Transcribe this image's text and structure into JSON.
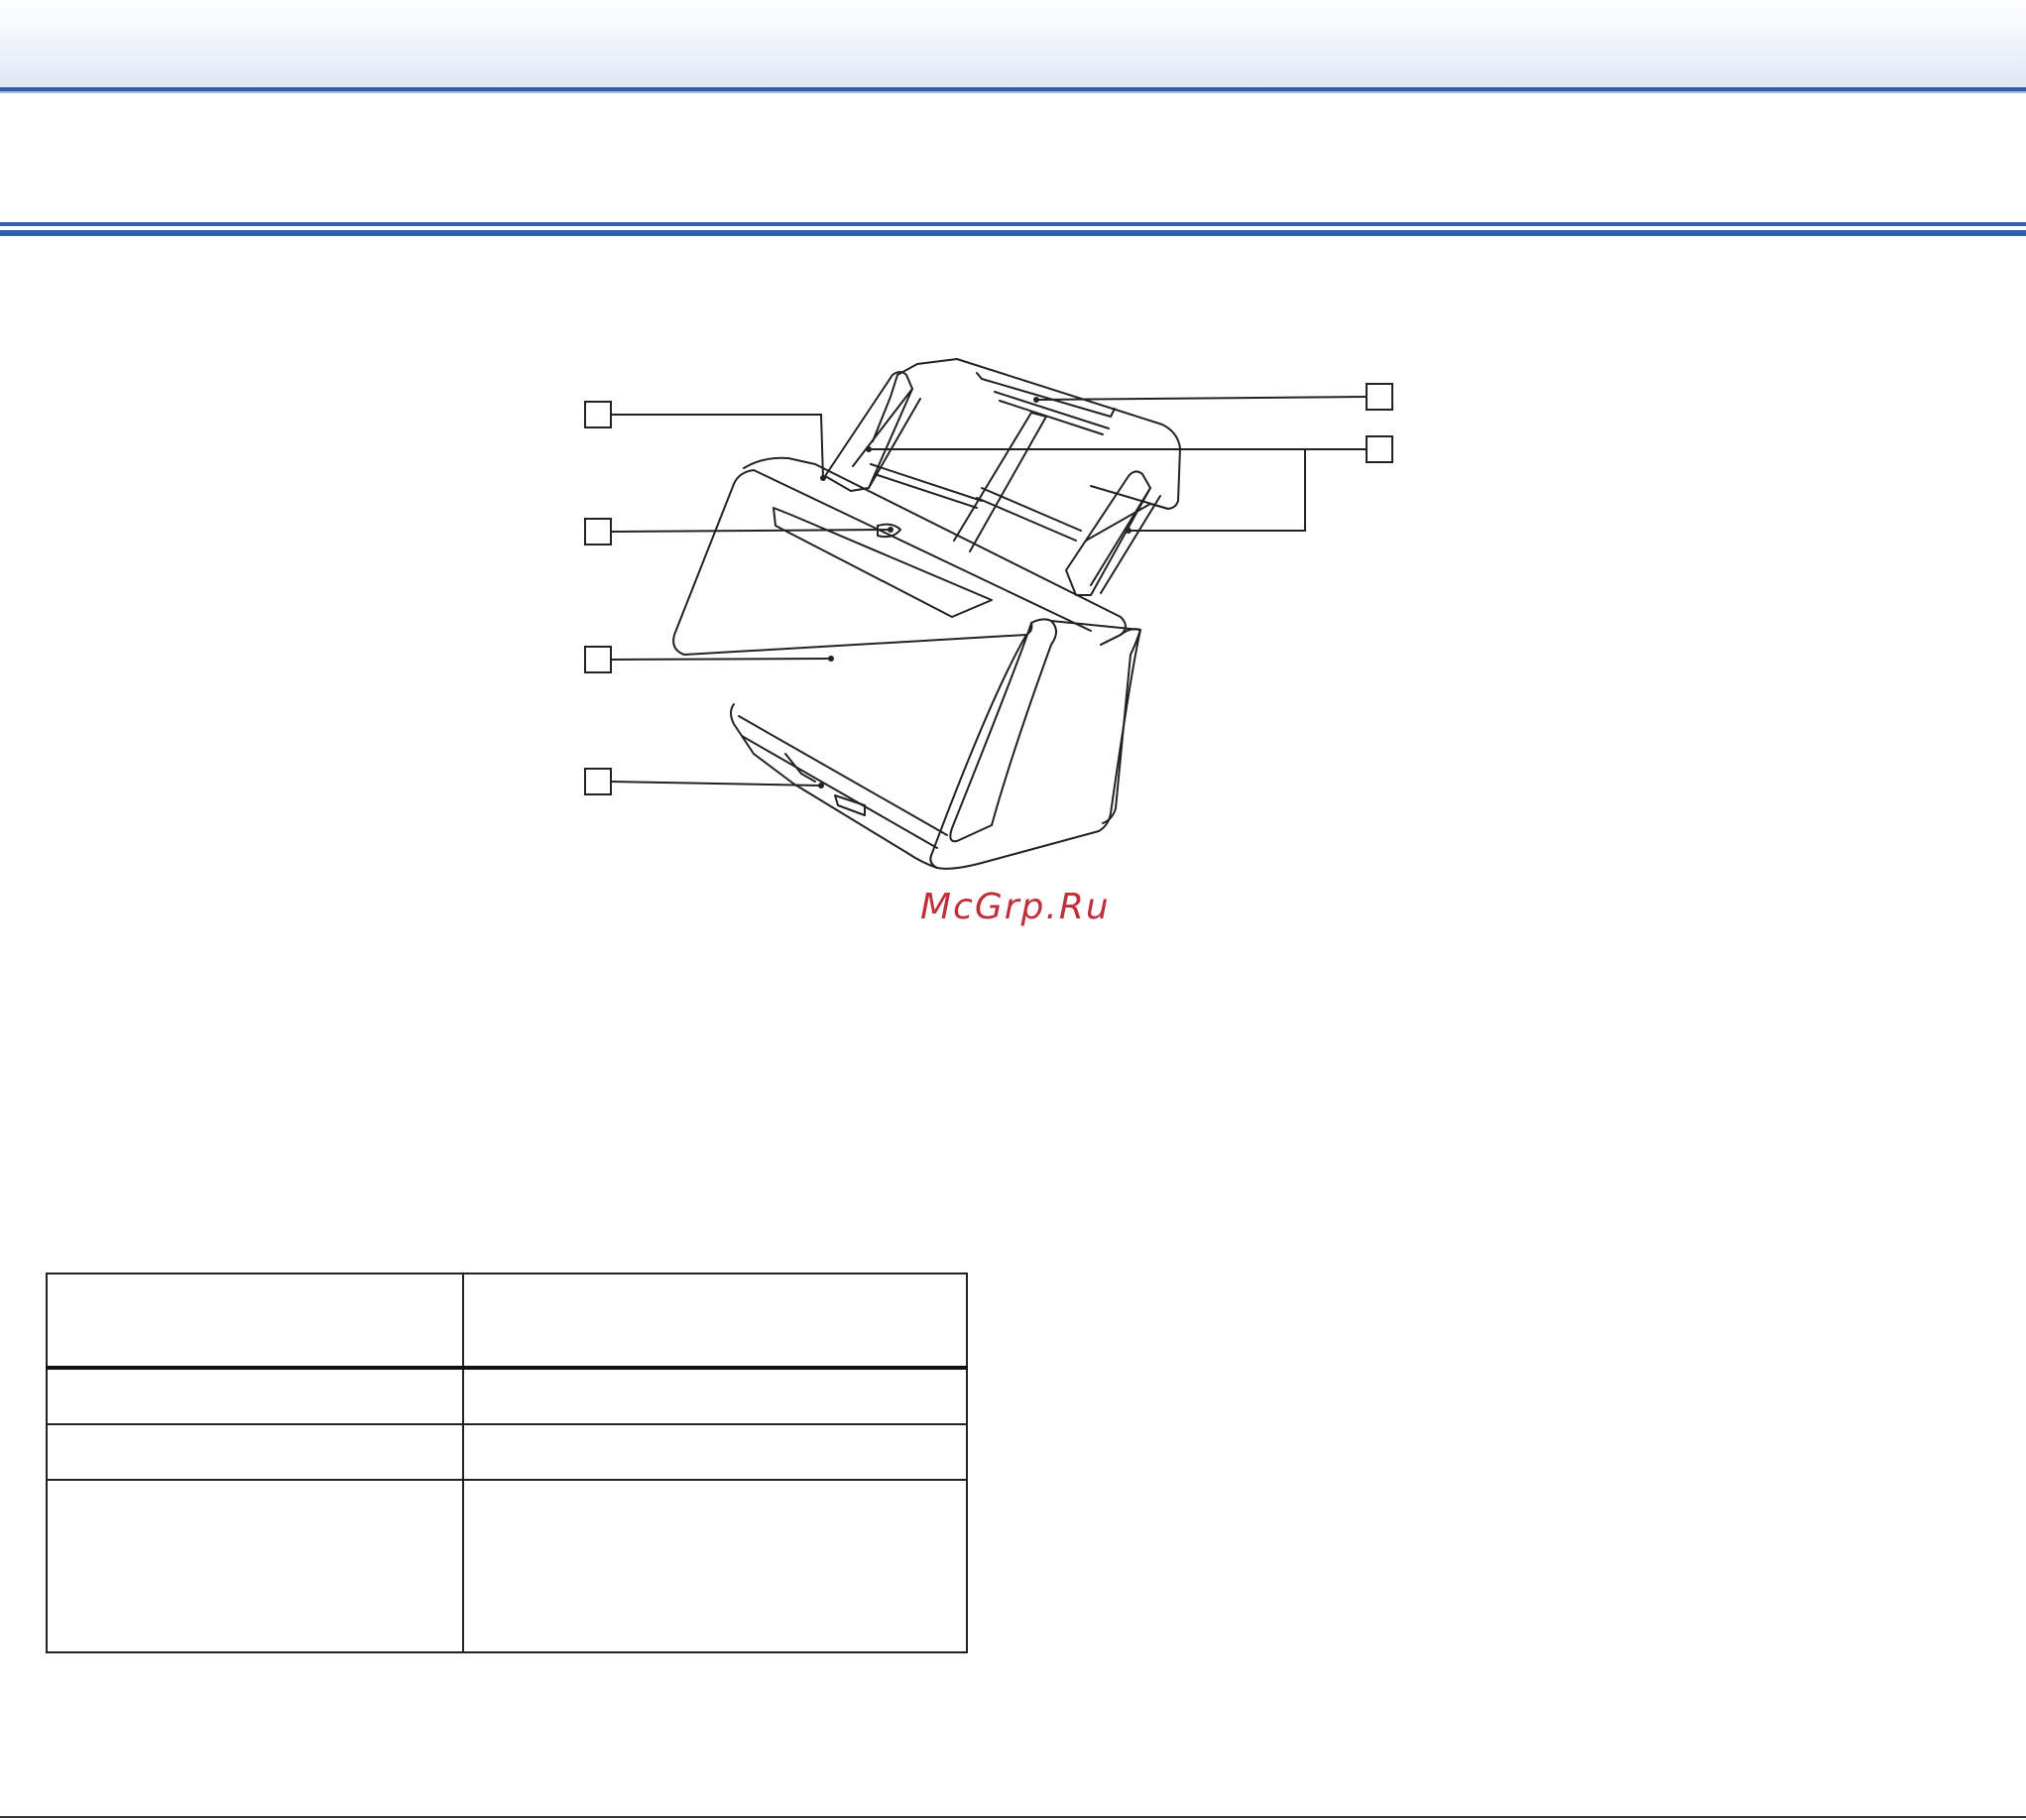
{
  "watermark": "McGrp.Ru",
  "figure": {
    "callouts": [
      "",
      "",
      "",
      "",
      "",
      ""
    ]
  },
  "table": {
    "header": [
      "",
      ""
    ],
    "rows": [
      [
        "",
        ""
      ],
      [
        "",
        ""
      ],
      [
        "",
        ""
      ]
    ]
  }
}
